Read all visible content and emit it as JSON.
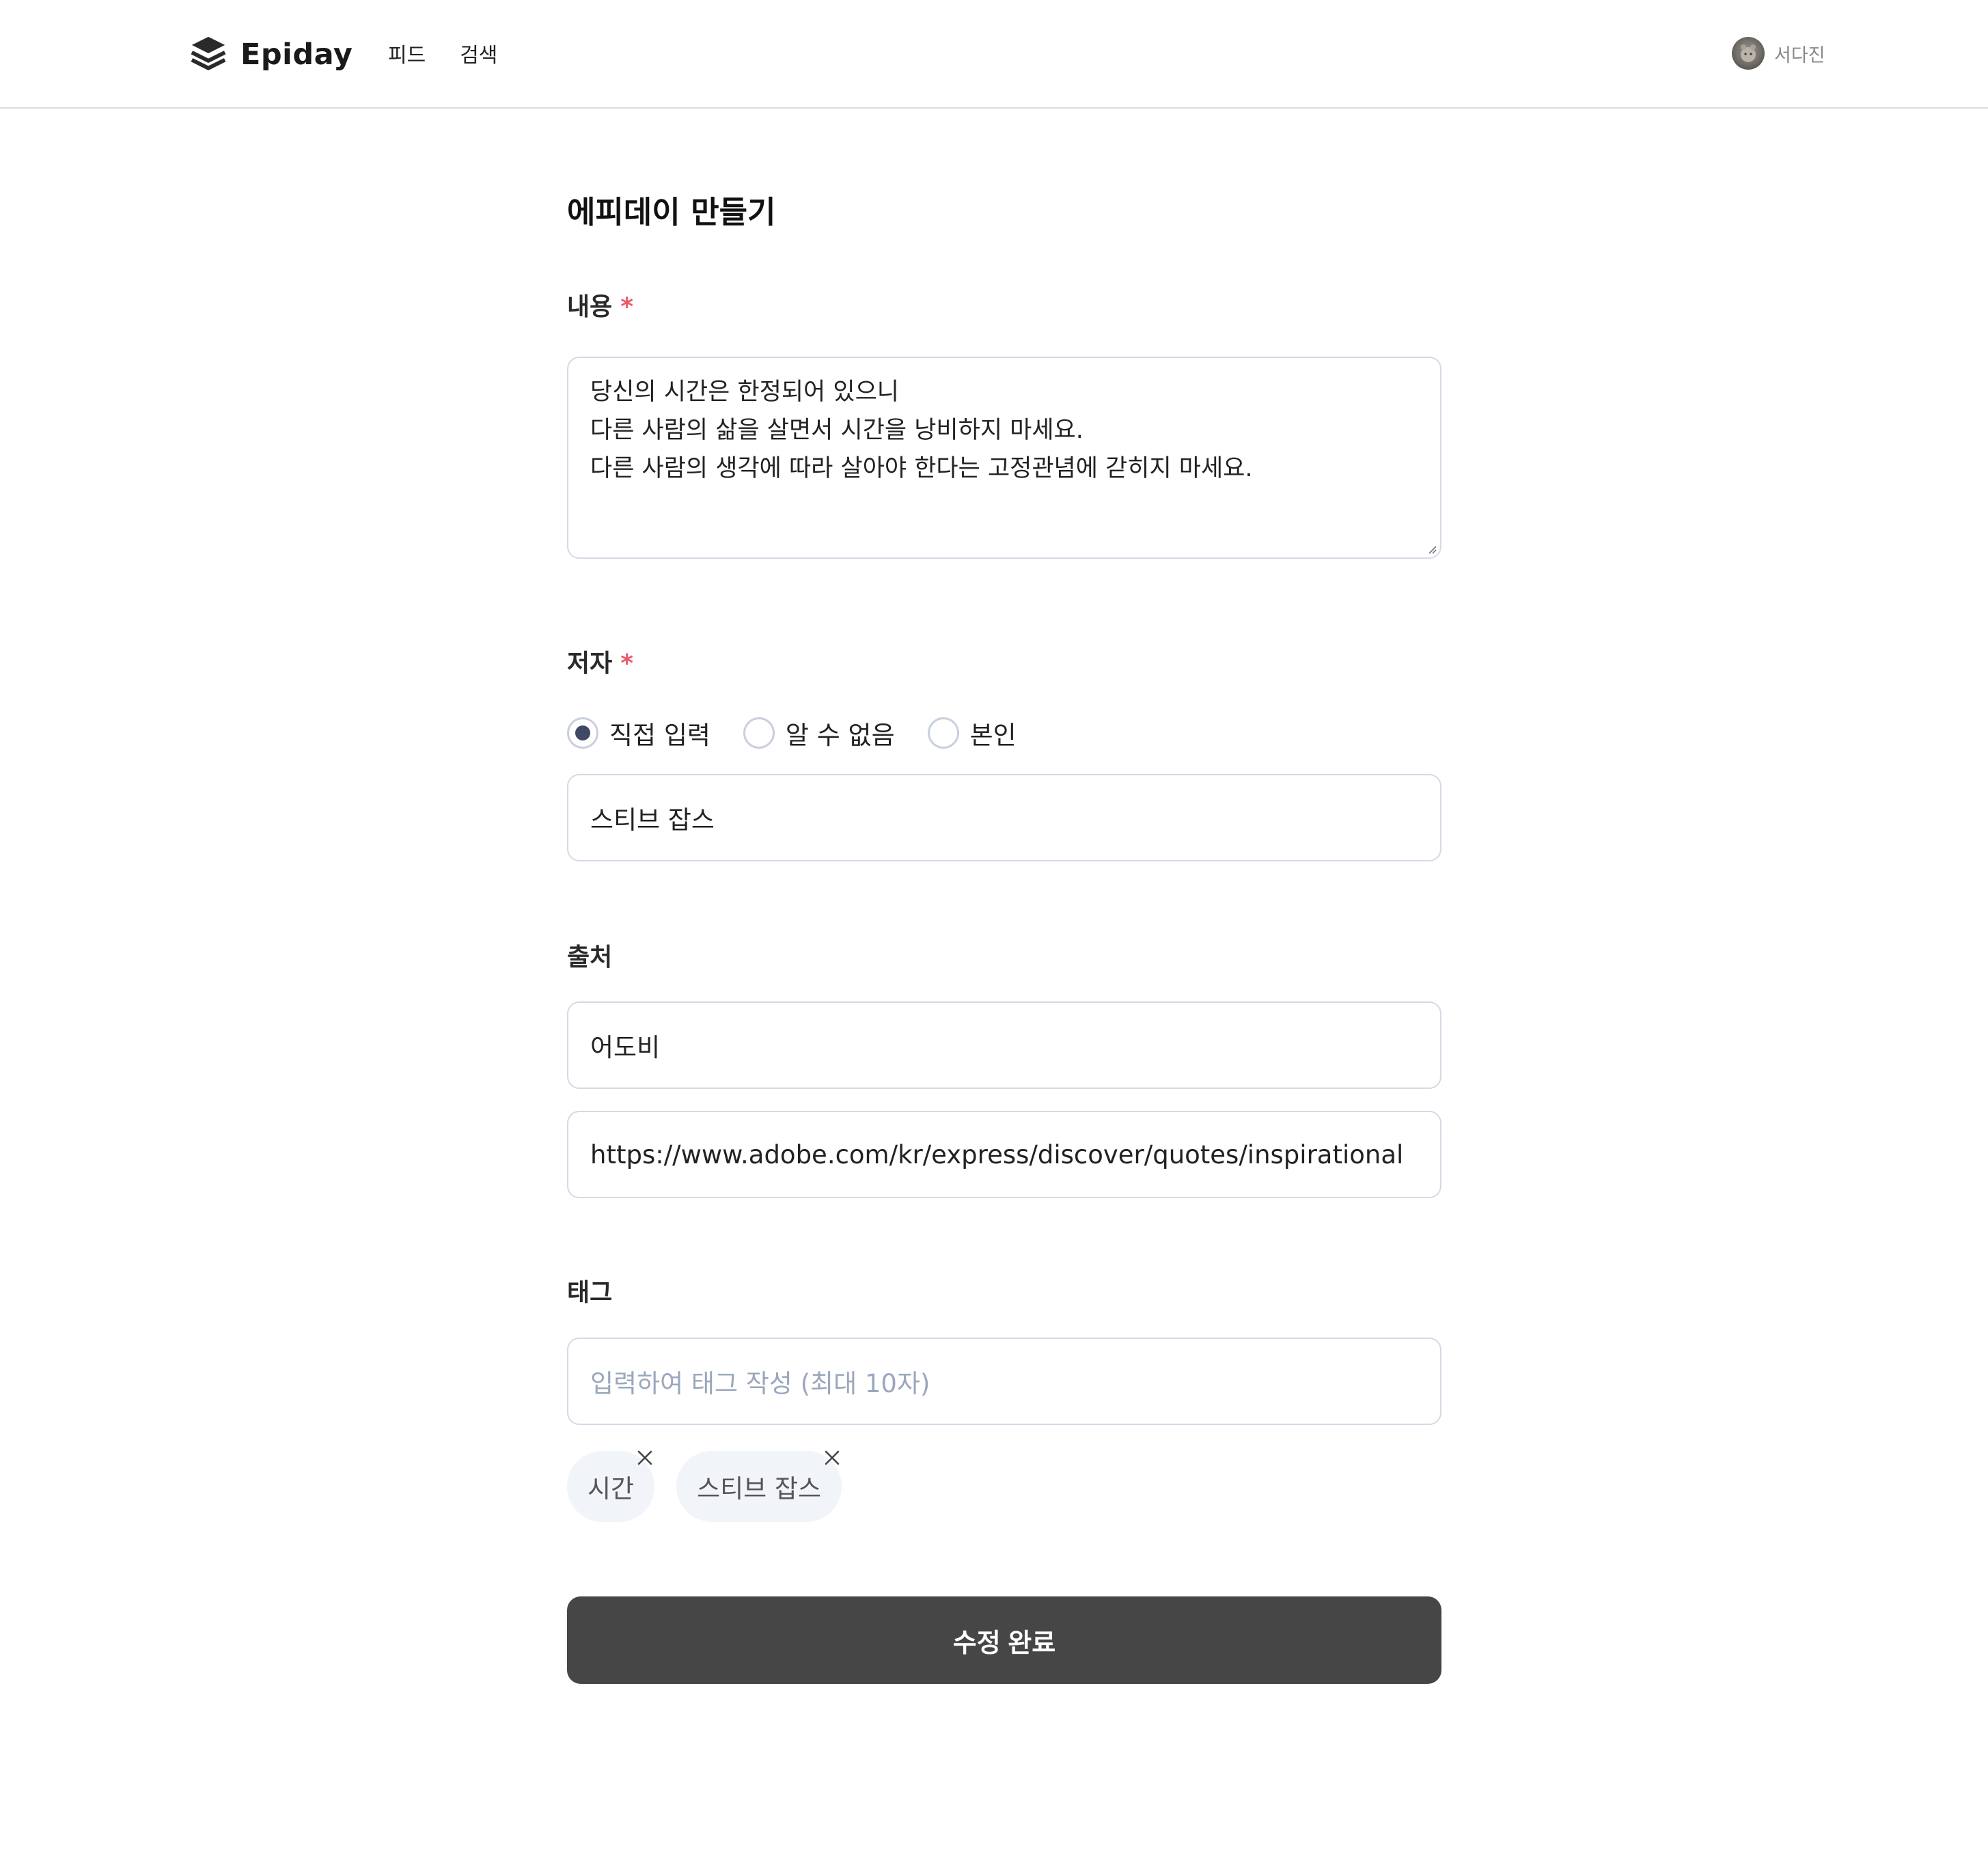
{
  "header": {
    "logo_text": "Epiday",
    "logo_icon": "layers-icon",
    "nav": [
      {
        "label": "피드"
      },
      {
        "label": "검색"
      }
    ],
    "user": {
      "name": "서다진",
      "avatar_icon": "user-avatar"
    }
  },
  "form": {
    "title": "에피데이 만들기",
    "content": {
      "label": "내용",
      "required_mark": "*",
      "lines": [
        "당신의 시간은 한정되어 있으니",
        "다른 사람의 삶을 살면서 시간을 낭비하지 마세요.",
        "다른 사람의 생각에 따라 살아야 한다는 고정관념에 갇히지 마세요."
      ]
    },
    "author": {
      "label": "저자",
      "required_mark": "*",
      "options": [
        {
          "label": "직접 입력",
          "checked": true
        },
        {
          "label": "알 수 없음",
          "checked": false
        },
        {
          "label": "본인",
          "checked": false
        }
      ],
      "value": "스티브 잡스"
    },
    "source": {
      "label": "출처",
      "title_value": "어도비",
      "url_value": "https://www.adobe.com/kr/express/discover/quotes/inspirational"
    },
    "tags": {
      "label": "태그",
      "placeholder": "입력하여 태그 작성 (최대 10자)",
      "items": [
        {
          "label": "시간"
        },
        {
          "label": "스티브 잡스"
        }
      ]
    },
    "submit_label": "수정 완료"
  },
  "colors": {
    "required": "#f0576b",
    "border": "#d6d9e6",
    "radio_checked": "#3f4966",
    "button_bg": "#464646",
    "tag_bg": "#f1f4f8",
    "placeholder": "#9aa7bd"
  }
}
